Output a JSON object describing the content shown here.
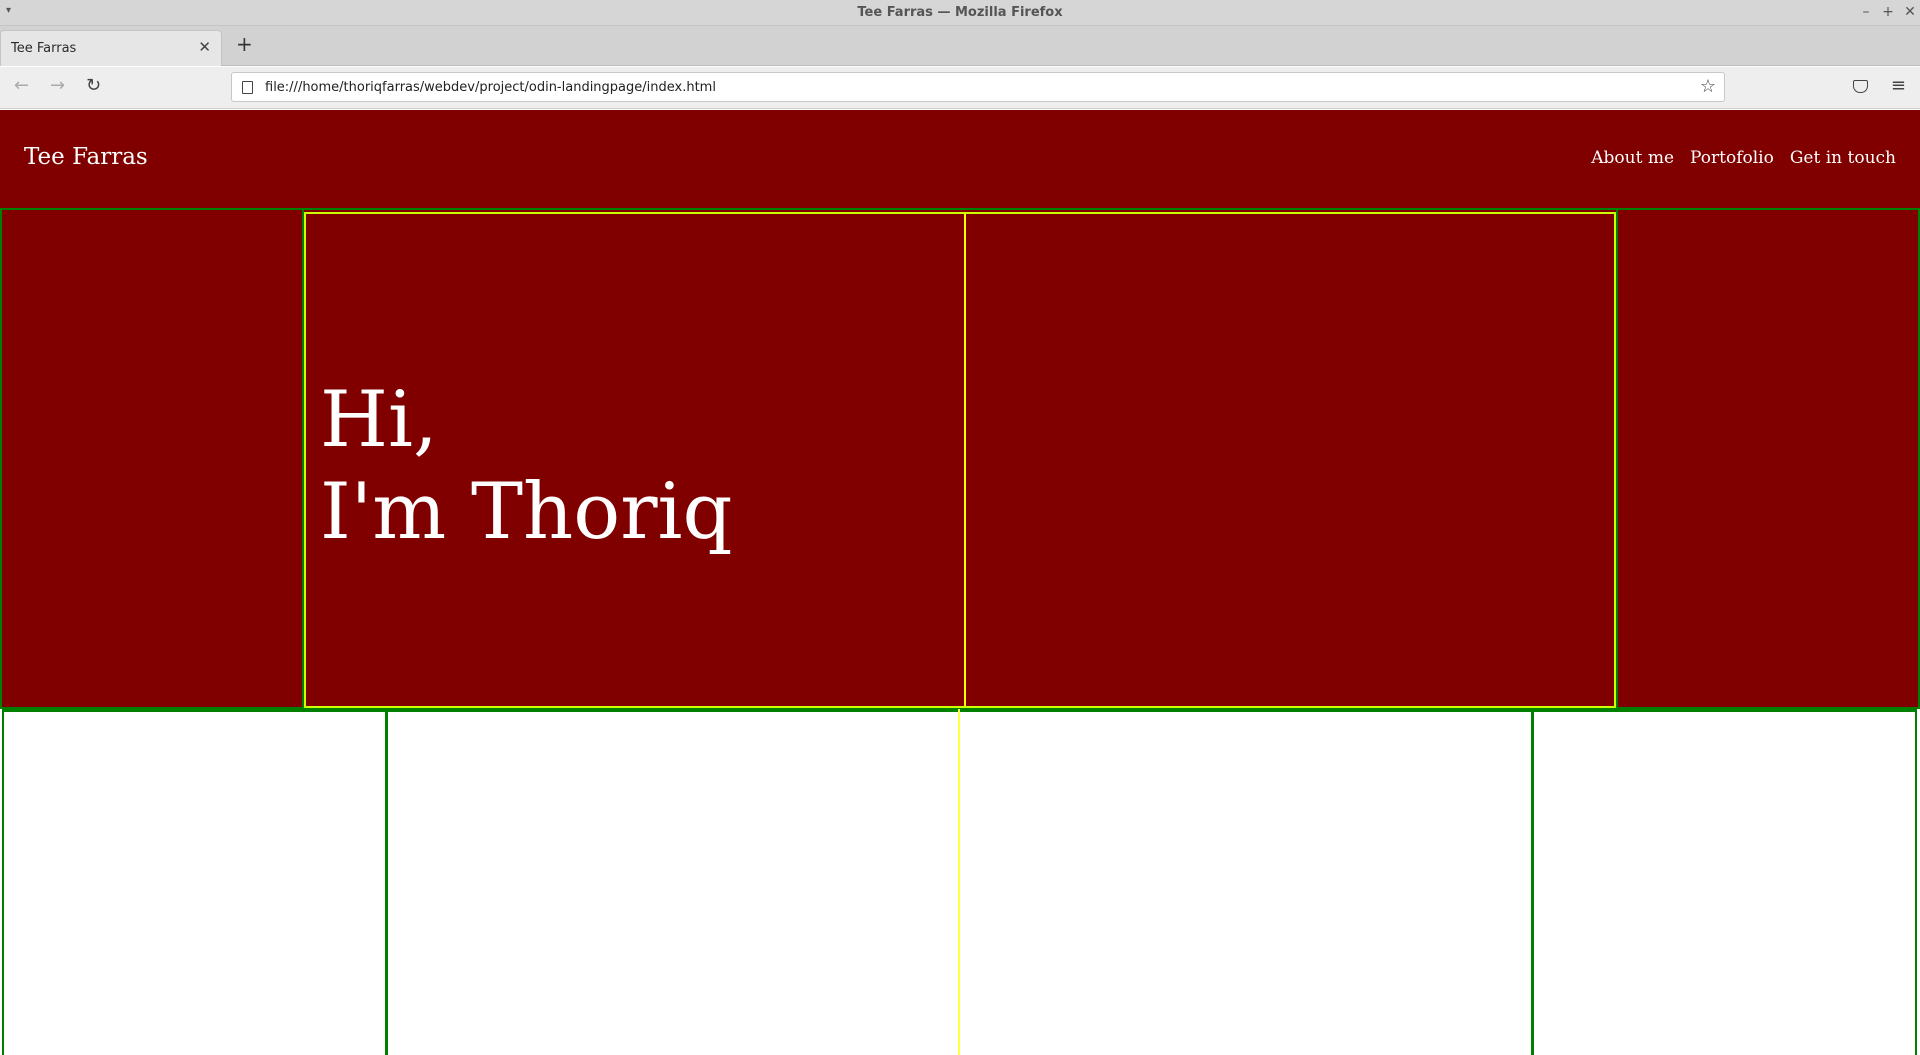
{
  "window": {
    "title": "Tee Farras — Mozilla Firefox",
    "controls": [
      "minimize",
      "maximize",
      "close"
    ]
  },
  "tabs": [
    {
      "label": "Tee Farras",
      "active": true
    }
  ],
  "toolbar": {
    "url": "file:///home/thoriqfarras/webdev/project/odin-landingpage/index.html"
  },
  "site": {
    "brand": "Tee Farras",
    "nav": [
      "About me",
      "Portofolio",
      "Get in touch"
    ],
    "hero": {
      "line1": "Hi,",
      "line2": "I'm Thoriq"
    }
  },
  "colors": {
    "header_bg": "#800000",
    "debug_outline_green": "#008000",
    "debug_outline_yellow": "#ffff00"
  }
}
